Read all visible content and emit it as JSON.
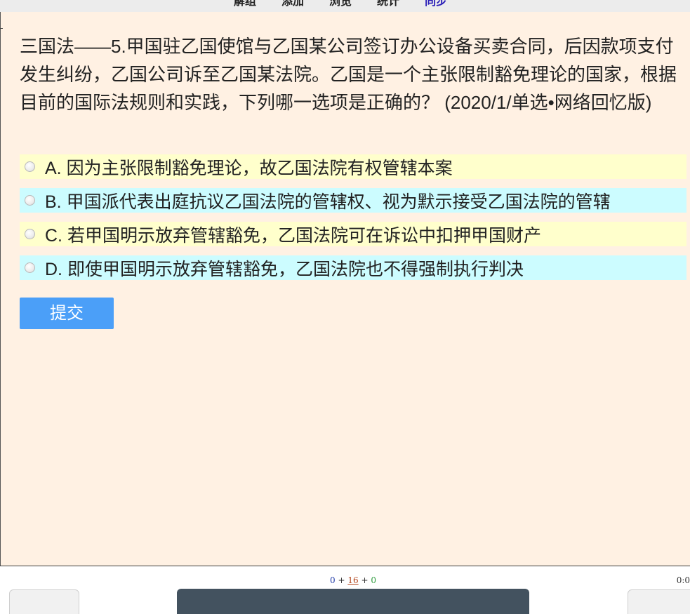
{
  "top_menu": {
    "items": [
      "解组",
      "添加",
      "浏览",
      "统计"
    ],
    "sync_label": "同步"
  },
  "question": {
    "text": "三国法——5.甲国驻乙国使馆与乙国某公司签订办公设备买卖合同，后因款项支付发生纠纷，乙国公司诉至乙国某法院。乙国是一个主张限制豁免理论的国家，根据目前的国际法规则和实践，下列哪一选项是正确的？ (2020/1/单选•网络回忆版)"
  },
  "options": [
    {
      "label": "A. 因为主张限制豁免理论，故乙国法院有权管辖本案",
      "color": "#ffffcc"
    },
    {
      "label": "B. 甲国派代表出庭抗议乙国法院的管辖权、视为默示接受乙国法院的管辖",
      "color": "#ccfcff"
    },
    {
      "label": "C. 若甲国明示放弃管辖豁免，乙国法院可在诉讼中扣押甲国财产",
      "color": "#ffffcc"
    },
    {
      "label": "D. 即使甲国明示放弃管辖豁免，乙国法院也不得强制执行判决",
      "color": "#ccfcff"
    }
  ],
  "submit_label": "提交",
  "status": {
    "done": "0",
    "sep1": " + ",
    "wrong": "16",
    "sep2": " + ",
    "right": "0",
    "timer": "0:0"
  },
  "colors": {
    "background": "#fff1e3",
    "submit": "#4b9ff8",
    "option_yellow": "#ffffcc",
    "option_cyan": "#ccfcff",
    "nav_center": "#43525f"
  }
}
